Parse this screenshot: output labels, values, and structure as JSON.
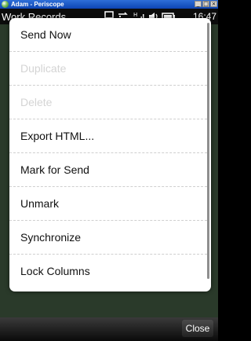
{
  "window": {
    "title": "Adam - Periscope",
    "controls": [
      "minimize",
      "maximize",
      "close"
    ]
  },
  "statusbar": {
    "title": "Work Records",
    "time": "16:47",
    "icons": [
      "connectivity-icon",
      "sync-icon",
      "signal-icon",
      "volume-icon",
      "battery-icon"
    ]
  },
  "menu": {
    "items": [
      {
        "label": "Send Now",
        "enabled": true
      },
      {
        "label": "Duplicate",
        "enabled": false
      },
      {
        "label": "Delete",
        "enabled": false
      },
      {
        "label": "Export HTML...",
        "enabled": true
      },
      {
        "label": "Mark for Send",
        "enabled": true
      },
      {
        "label": "Unmark",
        "enabled": true
      },
      {
        "label": "Synchronize",
        "enabled": true
      },
      {
        "label": "Lock Columns",
        "enabled": true
      }
    ]
  },
  "softbar": {
    "close_label": "Close"
  }
}
